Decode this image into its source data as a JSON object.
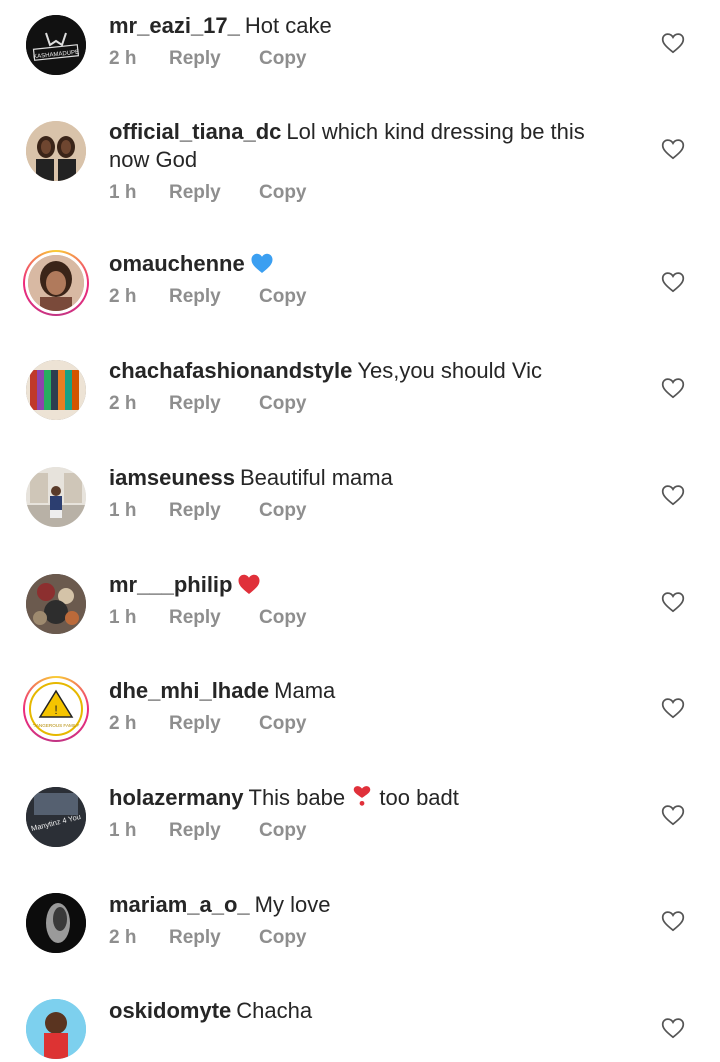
{
  "colors": {
    "text": "#262626",
    "meta": "#8e8e8e",
    "blue_heart": "#3b9ff1",
    "red_heart": "#e0303a",
    "story_ring": [
      "#f9ce34",
      "#ee2a7b",
      "#c13584"
    ]
  },
  "labels": {
    "reply": "Reply",
    "copy": "Copy"
  },
  "comments": [
    {
      "username": "mr_eazi_17_",
      "text": "Hot cake",
      "time": "2 h",
      "avatar_text": "KASHAMADUPE"
    },
    {
      "username": "official_tiana_dc",
      "text": "Lol which kind dressing be this now God",
      "time": "1 h"
    },
    {
      "username": "omauchenne",
      "text": "",
      "emoji": "blue-heart",
      "time": "2 h"
    },
    {
      "username": "chachafashionandstyle",
      "text": "Yes,you should Vic",
      "time": "2 h"
    },
    {
      "username": "iamseuness",
      "text": "Beautiful mama",
      "time": "1 h"
    },
    {
      "username": "mr___philip",
      "text": "",
      "emoji": "red-heart",
      "time": "1 h"
    },
    {
      "username": "dhe_mhi_lhade",
      "text": "Mama",
      "time": "2 h",
      "avatar_text": "DANGEROUS FAMILY"
    },
    {
      "username": "holazermany",
      "text": "This babe",
      "emoji": "heart-exclamation",
      "text_after": "too badt",
      "time": "1 h",
      "avatar_text": "Manytinz 4 You"
    },
    {
      "username": "mariam_a_o_",
      "text": "My love",
      "time": "2 h"
    },
    {
      "username": "oskidomyte",
      "text": "Chacha",
      "time": ""
    }
  ]
}
